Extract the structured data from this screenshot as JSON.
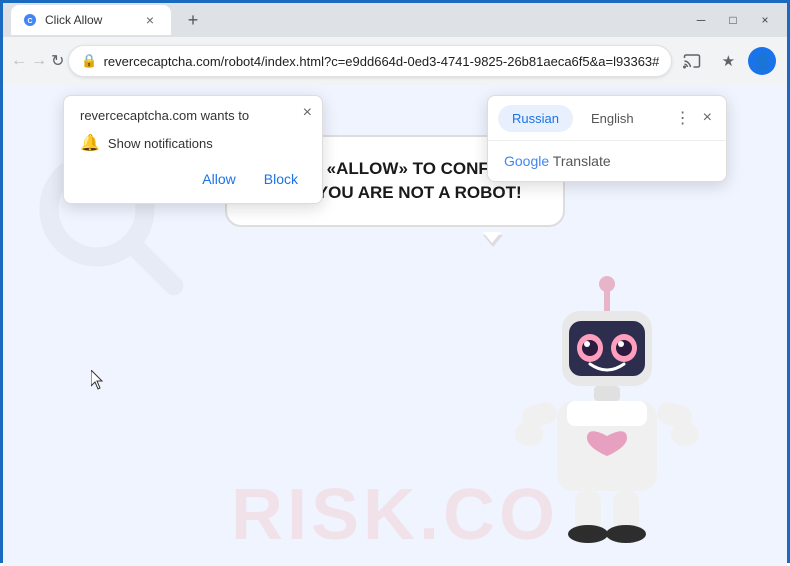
{
  "window": {
    "title": "Click Allow",
    "close_label": "×",
    "minimize_label": "─",
    "maximize_label": "□"
  },
  "tab": {
    "label": "Click Allow",
    "close_label": "×"
  },
  "new_tab_btn": "+",
  "omnibox": {
    "url": "revercecaptcha.com/robot4/index.html?c=e9dd664d-0ed3-4741-9825-26b81aeca6f5&a=l93363#"
  },
  "notification_popup": {
    "title": "revercecaptcha.com wants to",
    "item_text": "Show notifications",
    "allow_label": "Allow",
    "block_label": "Block",
    "close_label": "×"
  },
  "translate_popup": {
    "tab_russian": "Russian",
    "tab_english": "English",
    "google_label": "Google",
    "translate_label": "Translate",
    "more_label": "⋮",
    "close_label": "×"
  },
  "page": {
    "bubble_text": "CLICK «ALLOW» TO CONFIRM THAT YOU ARE NOT A ROBOT!",
    "watermark": "RISK.CO"
  },
  "colors": {
    "accent_blue": "#1a73e8",
    "border_blue": "#1a6abf",
    "page_bg": "#e8edf8"
  }
}
